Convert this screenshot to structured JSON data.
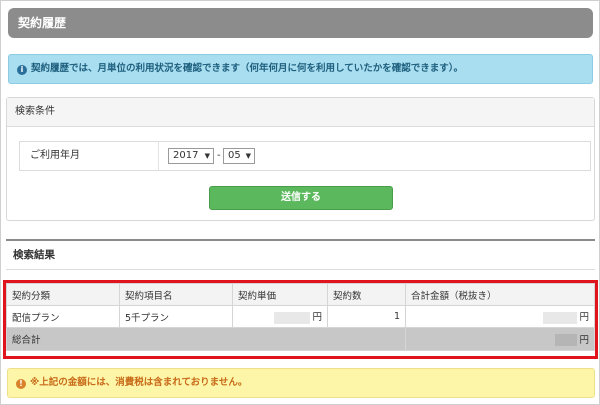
{
  "header": {
    "title": "契約履歴"
  },
  "info": {
    "icon": "info-circle-icon",
    "text": "契約履歴では、月単位の利用状況を確認できます（何年何月に何を利用していたかを確認できます）。"
  },
  "search": {
    "panel_title": "検索条件",
    "field_label": "ご利用年月",
    "year_value": "2017",
    "month_value": "05",
    "separator": "-",
    "submit_label": "送信する"
  },
  "results": {
    "title": "検索結果",
    "columns": [
      "契約分類",
      "契約項目名",
      "契約単価",
      "契約数",
      "合計金額（税抜き）"
    ],
    "rows": [
      {
        "category": "配信プラン",
        "item": "5千プラン",
        "unit_price_suffix": "円",
        "quantity": "1",
        "total_suffix": "円"
      }
    ],
    "total_label": "総合計",
    "grand_total_suffix": "円"
  },
  "warning": {
    "icon": "exclamation-circle-icon",
    "text": "※上記の金額には、消費税は含まれておりません。"
  },
  "colors": {
    "accent_green": "#5cb85c",
    "highlight_red": "#e0141c",
    "info_bg": "#a9ddf0",
    "warn_bg": "#fdf6a8"
  }
}
